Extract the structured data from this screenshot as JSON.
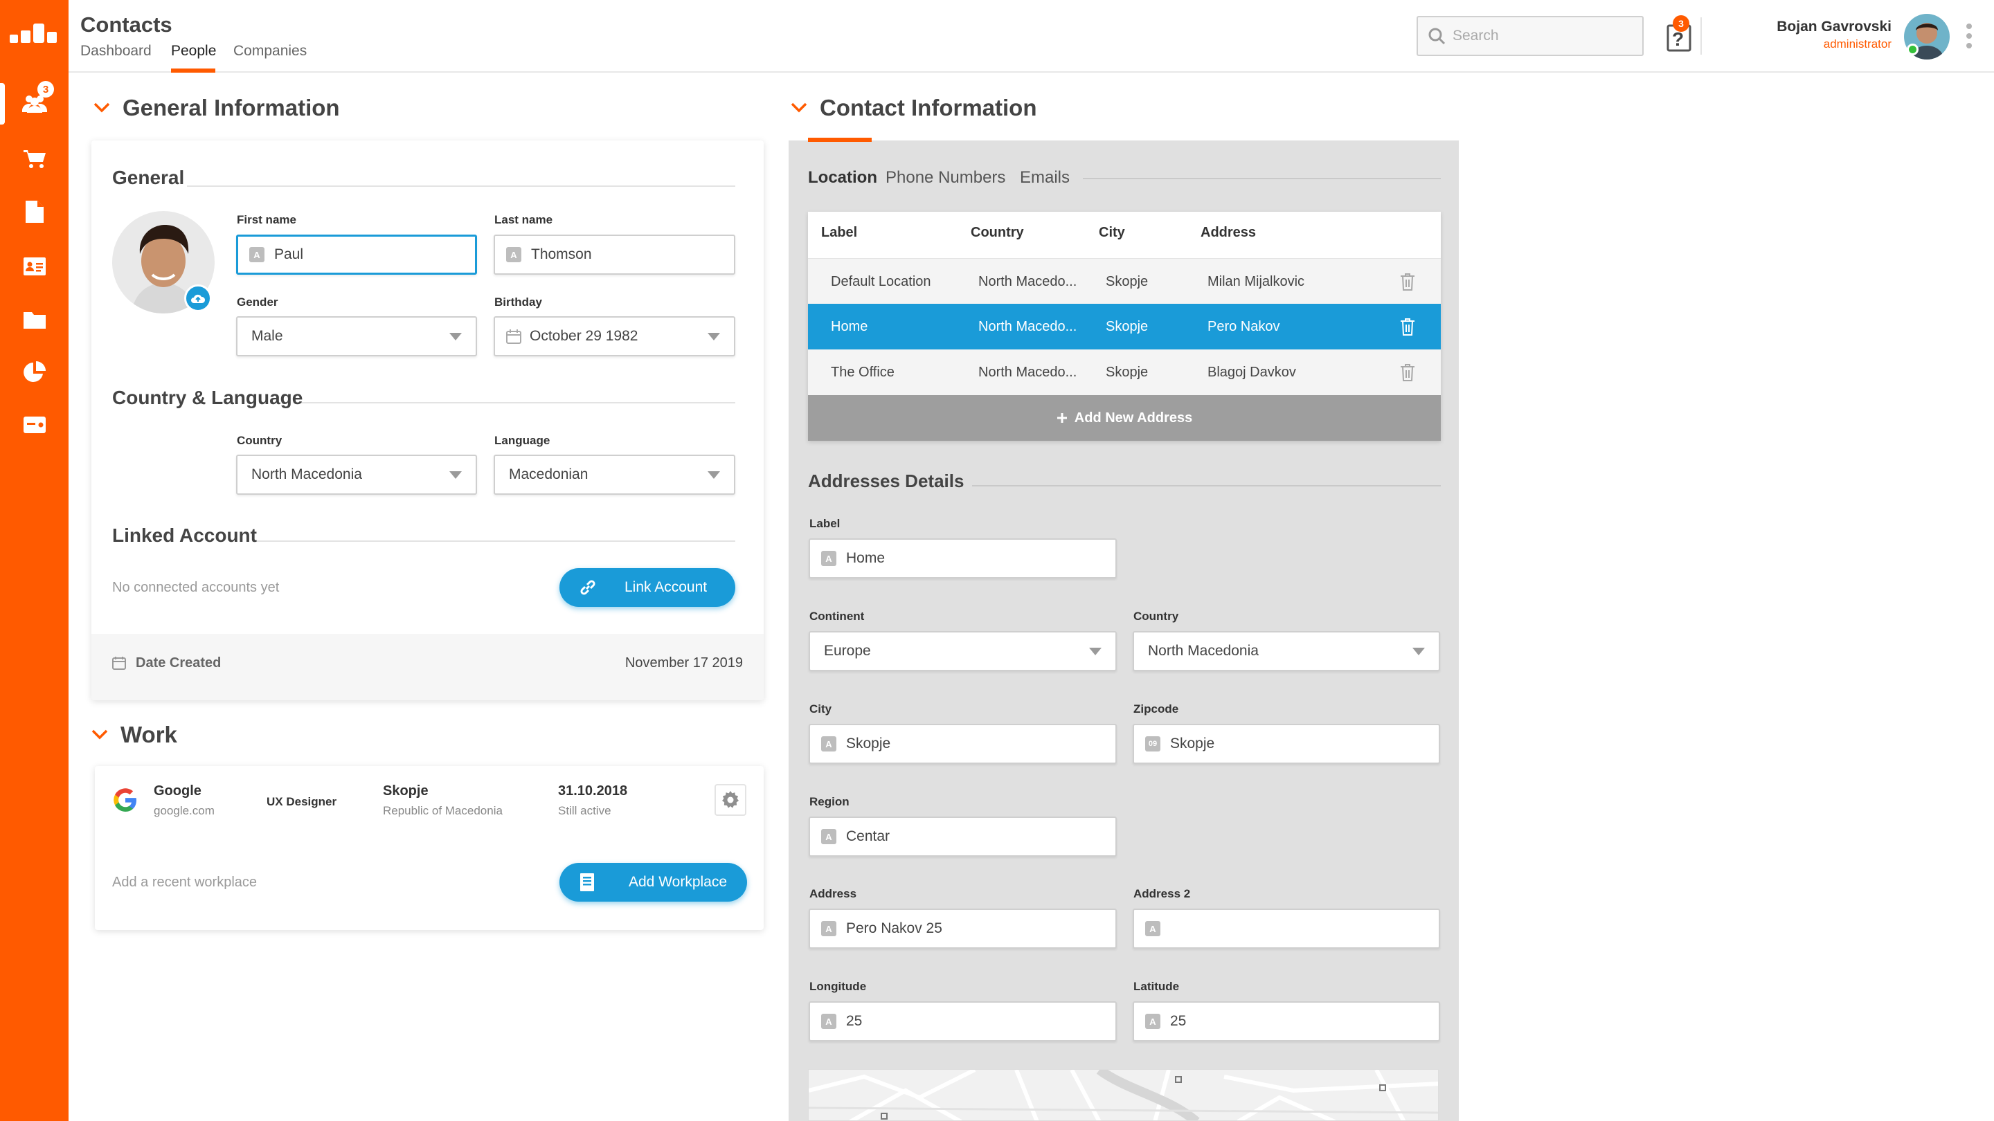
{
  "app": {
    "title": "Contacts"
  },
  "header": {
    "tabs": [
      "Dashboard",
      "People",
      "Companies"
    ],
    "active_tab": "People",
    "search_placeholder": "Search",
    "help_badge": "3",
    "help_glyph": "?",
    "user": {
      "name": "Bojan Gavrovski",
      "role": "administrator",
      "status": "online"
    }
  },
  "sidebar": {
    "items": [
      {
        "icon": "users-icon",
        "badge": "3",
        "active": true
      },
      {
        "icon": "cart-icon"
      },
      {
        "icon": "document-icon"
      },
      {
        "icon": "contact-card-icon"
      },
      {
        "icon": "folder-icon"
      },
      {
        "icon": "pie-chart-icon"
      },
      {
        "icon": "ticket-icon"
      }
    ]
  },
  "general": {
    "section_title": "General Information",
    "subsection": "General",
    "first_name": {
      "label": "First name",
      "value": "Paul",
      "prefix": "A"
    },
    "last_name": {
      "label": "Last name",
      "value": "Thomson",
      "prefix": "A"
    },
    "gender": {
      "label": "Gender",
      "value": "Male"
    },
    "birthday": {
      "label": "Birthday",
      "value": "October 29 1982"
    },
    "country_language": {
      "title": "Country & Language",
      "country": {
        "label": "Country",
        "value": "North Macedonia"
      },
      "language": {
        "label": "Language",
        "value": "Macedonian"
      }
    },
    "linked": {
      "title": "Linked Account",
      "empty": "No connected accounts yet",
      "button": "Link Account"
    },
    "date_created": {
      "label": "Date Created",
      "value": "November 17 2019"
    }
  },
  "work": {
    "section_title": "Work",
    "entry": {
      "company": "Google",
      "domain": "google.com",
      "role": "UX Designer",
      "city": "Skopje",
      "country": "Republic of Macedonia",
      "date": "31.10.2018",
      "status": "Still active"
    },
    "empty": "Add a recent workplace",
    "button": "Add Workplace"
  },
  "contact": {
    "section_title": "Contact Information",
    "tabs": [
      "Location",
      "Phone Numbers",
      "Emails"
    ],
    "active_tab": "Location",
    "table": {
      "headers": [
        "Label",
        "Country",
        "City",
        "Address"
      ],
      "rows": [
        {
          "label": "Default Location",
          "country": "North Macedo...",
          "city": "Skopje",
          "address": "Milan Mijalkovic"
        },
        {
          "label": "Home",
          "country": "North Macedo...",
          "city": "Skopje",
          "address": "Pero Nakov",
          "selected": true
        },
        {
          "label": "The Office",
          "country": "North Macedo...",
          "city": "Skopje",
          "address": "Blagoj Davkov"
        }
      ],
      "add_label": "Add New Address"
    },
    "details": {
      "title": "Addresses Details",
      "label": {
        "label": "Label",
        "value": "Home",
        "prefix": "A"
      },
      "continent": {
        "label": "Continent",
        "value": "Europe"
      },
      "country": {
        "label": "Country",
        "value": "North Macedonia"
      },
      "city": {
        "label": "City",
        "value": "Skopje",
        "prefix": "A"
      },
      "zipcode": {
        "label": "Zipcode",
        "value": "Skopje",
        "prefix": "09"
      },
      "region": {
        "label": "Region",
        "value": "Centar",
        "prefix": "A"
      },
      "address": {
        "label": "Address",
        "value": "Pero Nakov 25",
        "prefix": "A"
      },
      "address2": {
        "label": "Address 2",
        "value": "",
        "prefix": "A"
      },
      "longitude": {
        "label": "Longitude",
        "value": "25",
        "prefix": "A"
      },
      "latitude": {
        "label": "Latitude",
        "value": "25",
        "prefix": "A"
      }
    }
  },
  "colors": {
    "accent": "#ff5a00",
    "primary": "#1a9bd8",
    "panel": "#e0e0e0",
    "selected_row": "#1a9bd8"
  }
}
